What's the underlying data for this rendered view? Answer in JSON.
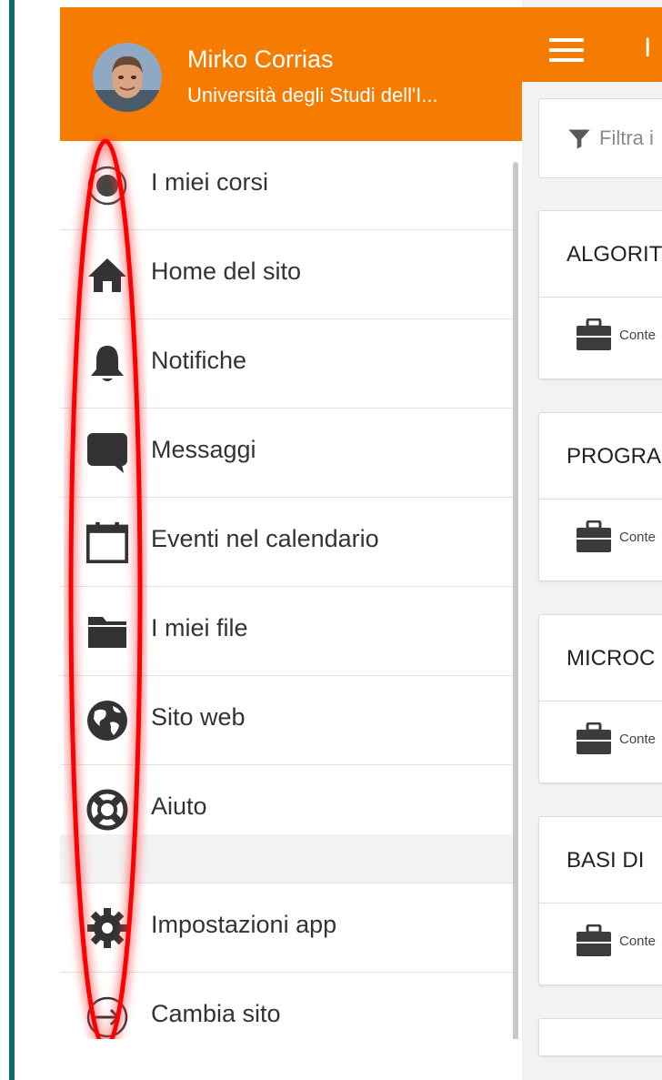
{
  "drawer": {
    "user_name": "Mirko Corrias",
    "user_site": "Università degli Studi dell'I...",
    "items": [
      {
        "label": "I miei corsi",
        "icon": "radio-icon"
      },
      {
        "label": "Home del sito",
        "icon": "home-icon"
      },
      {
        "label": "Notifiche",
        "icon": "bell-icon"
      },
      {
        "label": "Messaggi",
        "icon": "chat-icon"
      },
      {
        "label": "Eventi nel calendario",
        "icon": "calendar-icon"
      },
      {
        "label": "I miei file",
        "icon": "folder-icon"
      },
      {
        "label": "Sito web",
        "icon": "globe-icon"
      },
      {
        "label": "Aiuto",
        "icon": "lifebuoy-icon"
      }
    ],
    "bottom_items": [
      {
        "label": "Impostazioni app",
        "icon": "gear-icon"
      },
      {
        "label": "Cambia sito",
        "icon": "switch-site-icon"
      }
    ]
  },
  "content": {
    "title": "I",
    "filter_placeholder": "Filtra i",
    "courses": [
      {
        "title": "ALGORIT",
        "label": "Conte"
      },
      {
        "title": "PROGRA",
        "label": "Conte"
      },
      {
        "title": "MICROC",
        "label": "Conte"
      },
      {
        "title": "BASI DI",
        "label": "Conte"
      }
    ]
  },
  "colors": {
    "header": "#f57c00",
    "accent_border": "#0a6e63",
    "annotation": "#ff0000",
    "icon": "#333333"
  }
}
